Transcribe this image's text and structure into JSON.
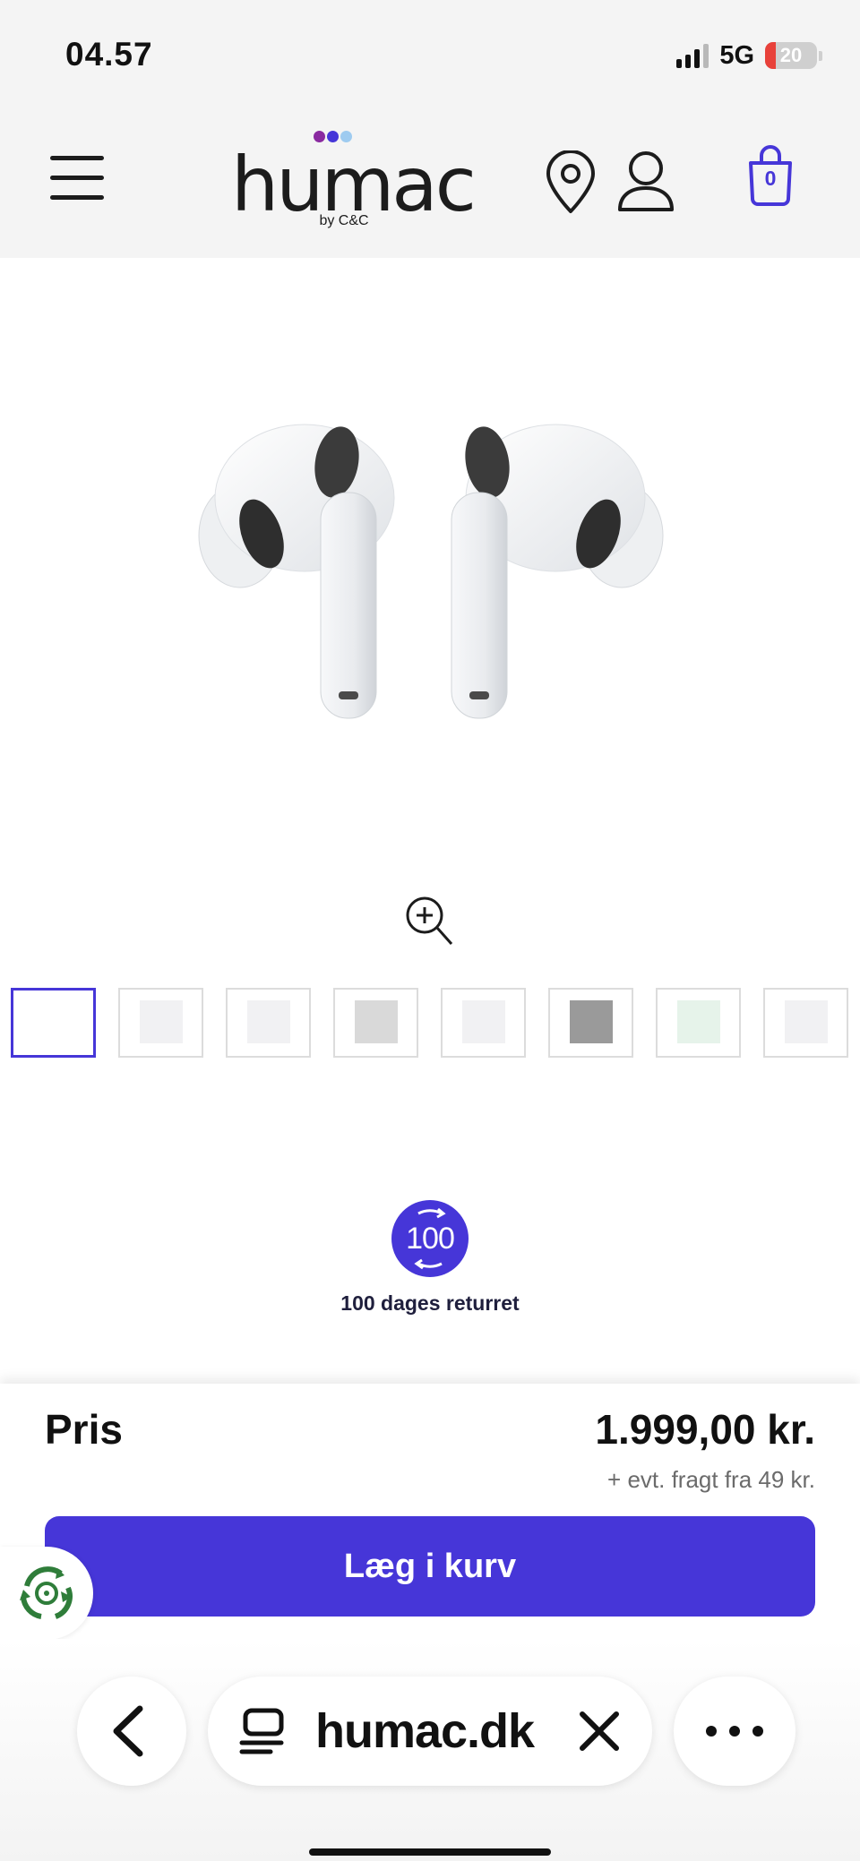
{
  "status_bar": {
    "time": "04.57",
    "network": "5G",
    "battery_level": "20"
  },
  "header": {
    "logo_text": "humac",
    "logo_byline": "by C&C",
    "cart_count": "0",
    "brand_dot_colors": [
      "#8a2aa0",
      "#4636d8",
      "#9ecbf0"
    ]
  },
  "product": {
    "thumbnail_count": 8
  },
  "returns": {
    "badge_number": "100",
    "label": "100 dages returret"
  },
  "purchase": {
    "price_label": "Pris",
    "price_value": "1.999,00 kr.",
    "shipping_note": "+ evt. fragt fra 49 kr.",
    "add_to_cart_label": "Læg i kurv"
  },
  "browser": {
    "url": "humac.dk"
  },
  "colors": {
    "accent": "#4636d8",
    "header_bg": "#f4f4f4"
  }
}
